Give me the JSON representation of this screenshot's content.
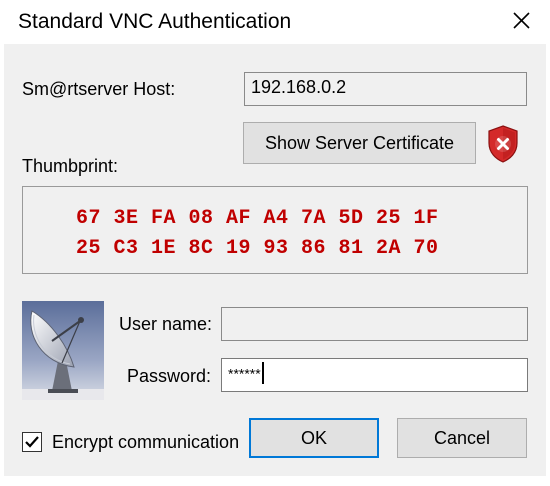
{
  "window": {
    "title": "Standard VNC Authentication"
  },
  "host": {
    "label": "Sm@rtserver Host:",
    "value": "192.168.0.2"
  },
  "certificate": {
    "button_label": "Show Server Certificate",
    "warning_icon": "red-shield-x-icon"
  },
  "thumbprint": {
    "label": "Thumbprint:",
    "line1": "67 3E FA 08 AF A4 7A 5D 25 1F",
    "line2": "25 C3 1E 8C 19 93 86 81 2A 70"
  },
  "credentials": {
    "username_label": "User name:",
    "username_value": "",
    "password_label": "Password:",
    "password_value": "******"
  },
  "footer": {
    "encrypt_label": "Encrypt communication",
    "encrypt_checked": true,
    "ok_label": "OK",
    "cancel_label": "Cancel"
  },
  "colors": {
    "thumbprint_text": "#c00000",
    "dialog_bg": "#f0f0f0",
    "focus_border": "#0078d7"
  }
}
